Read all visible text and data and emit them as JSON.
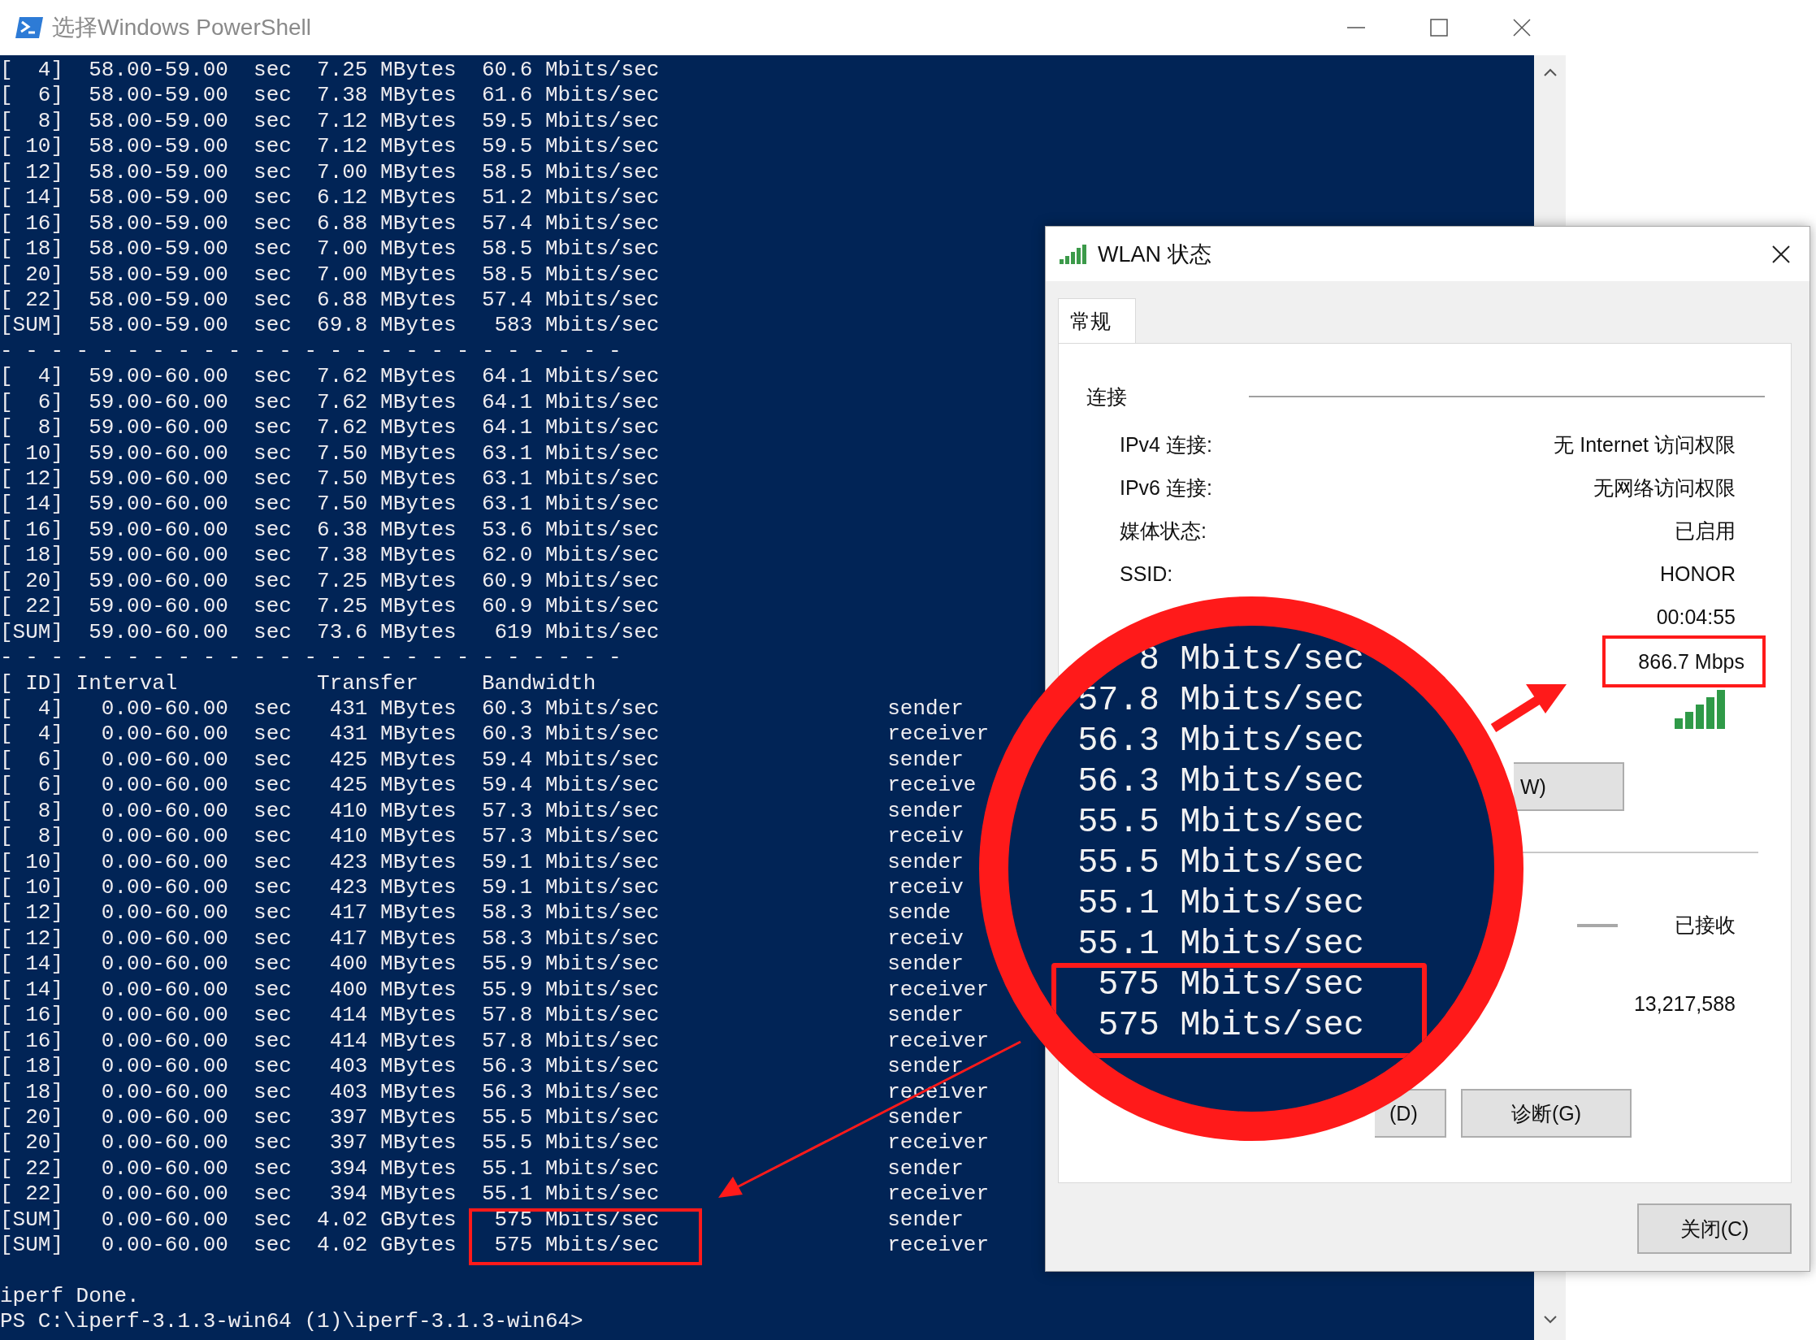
{
  "powershell": {
    "title": "选择Windows PowerShell",
    "lines": [
      {
        "text": "[  4]  58.00-59.00  sec  7.25 MBytes  60.6 Mbits/sec"
      },
      {
        "text": "[  6]  58.00-59.00  sec  7.38 MBytes  61.6 Mbits/sec"
      },
      {
        "text": "[  8]  58.00-59.00  sec  7.12 MBytes  59.5 Mbits/sec"
      },
      {
        "text": "[ 10]  58.00-59.00  sec  7.12 MBytes  59.5 Mbits/sec"
      },
      {
        "text": "[ 12]  58.00-59.00  sec  7.00 MBytes  58.5 Mbits/sec"
      },
      {
        "text": "[ 14]  58.00-59.00  sec  6.12 MBytes  51.2 Mbits/sec"
      },
      {
        "text": "[ 16]  58.00-59.00  sec  6.88 MBytes  57.4 Mbits/sec"
      },
      {
        "text": "[ 18]  58.00-59.00  sec  7.00 MBytes  58.5 Mbits/sec"
      },
      {
        "text": "[ 20]  58.00-59.00  sec  7.00 MBytes  58.5 Mbits/sec"
      },
      {
        "text": "[ 22]  58.00-59.00  sec  6.88 MBytes  57.4 Mbits/sec"
      },
      {
        "text": "[SUM]  58.00-59.00  sec  69.8 MBytes   583 Mbits/sec"
      },
      {
        "text": "- - - - - - - - - - - - - - - - - - - - - - - - -"
      },
      {
        "text": "[  4]  59.00-60.00  sec  7.62 MBytes  64.1 Mbits/sec"
      },
      {
        "text": "[  6]  59.00-60.00  sec  7.62 MBytes  64.1 Mbits/sec"
      },
      {
        "text": "[  8]  59.00-60.00  sec  7.62 MBytes  64.1 Mbits/sec"
      },
      {
        "text": "[ 10]  59.00-60.00  sec  7.50 MBytes  63.1 Mbits/sec"
      },
      {
        "text": "[ 12]  59.00-60.00  sec  7.50 MBytes  63.1 Mbits/sec"
      },
      {
        "text": "[ 14]  59.00-60.00  sec  7.50 MBytes  63.1 Mbits/sec"
      },
      {
        "text": "[ 16]  59.00-60.00  sec  6.38 MBytes  53.6 Mbits/sec"
      },
      {
        "text": "[ 18]  59.00-60.00  sec  7.38 MBytes  62.0 Mbits/sec"
      },
      {
        "text": "[ 20]  59.00-60.00  sec  7.25 MBytes  60.9 Mbits/sec"
      },
      {
        "text": "[ 22]  59.00-60.00  sec  7.25 MBytes  60.9 Mbits/sec"
      },
      {
        "text": "[SUM]  59.00-60.00  sec  73.6 MBytes   619 Mbits/sec"
      },
      {
        "text": "- - - - - - - - - - - - - - - - - - - - - - - - -"
      },
      {
        "text": "[ ID] Interval           Transfer     Bandwidth"
      },
      {
        "text": "[  4]   0.00-60.00  sec   431 MBytes  60.3 Mbits/sec",
        "role": "sender"
      },
      {
        "text": "[  4]   0.00-60.00  sec   431 MBytes  60.3 Mbits/sec",
        "role": "receiver"
      },
      {
        "text": "[  6]   0.00-60.00  sec   425 MBytes  59.4 Mbits/sec",
        "role": "sender"
      },
      {
        "text": "[  6]   0.00-60.00  sec   425 MBytes  59.4 Mbits/sec",
        "role": "receive"
      },
      {
        "text": "[  8]   0.00-60.00  sec   410 MBytes  57.3 Mbits/sec",
        "role": "sender"
      },
      {
        "text": "[  8]   0.00-60.00  sec   410 MBytes  57.3 Mbits/sec",
        "role": "receiv"
      },
      {
        "text": "[ 10]   0.00-60.00  sec   423 MBytes  59.1 Mbits/sec",
        "role": "sender"
      },
      {
        "text": "[ 10]   0.00-60.00  sec   423 MBytes  59.1 Mbits/sec",
        "role": "receiv"
      },
      {
        "text": "[ 12]   0.00-60.00  sec   417 MBytes  58.3 Mbits/sec",
        "role": "sende"
      },
      {
        "text": "[ 12]   0.00-60.00  sec   417 MBytes  58.3 Mbits/sec",
        "role": "receiv"
      },
      {
        "text": "[ 14]   0.00-60.00  sec   400 MBytes  55.9 Mbits/sec",
        "role": "sender"
      },
      {
        "text": "[ 14]   0.00-60.00  sec   400 MBytes  55.9 Mbits/sec",
        "role": "receiver"
      },
      {
        "text": "[ 16]   0.00-60.00  sec   414 MBytes  57.8 Mbits/sec",
        "role": "sender"
      },
      {
        "text": "[ 16]   0.00-60.00  sec   414 MBytes  57.8 Mbits/sec",
        "role": "receiver"
      },
      {
        "text": "[ 18]   0.00-60.00  sec   403 MBytes  56.3 Mbits/sec",
        "role": "sender"
      },
      {
        "text": "[ 18]   0.00-60.00  sec   403 MBytes  56.3 Mbits/sec",
        "role": "receiver"
      },
      {
        "text": "[ 20]   0.00-60.00  sec   397 MBytes  55.5 Mbits/sec",
        "role": "sender"
      },
      {
        "text": "[ 20]   0.00-60.00  sec   397 MBytes  55.5 Mbits/sec",
        "role": "receiver"
      },
      {
        "text": "[ 22]   0.00-60.00  sec   394 MBytes  55.1 Mbits/sec",
        "role": "sender"
      },
      {
        "text": "[ 22]   0.00-60.00  sec   394 MBytes  55.1 Mbits/sec",
        "role": "receiver"
      },
      {
        "text": "[SUM]   0.00-60.00  sec  4.02 GBytes   575 Mbits/sec",
        "role": "sender"
      },
      {
        "text": "[SUM]   0.00-60.00  sec  4.02 GBytes   575 Mbits/sec",
        "role": "receiver"
      }
    ],
    "after_blank_line": [
      "iperf Done.",
      "PS C:\\iperf-3.1.3-win64 (1)\\iperf-3.1.3-win64>"
    ]
  },
  "wlan_dialog": {
    "title": "WLAN 状态",
    "tabs": [
      {
        "label": "常规",
        "selected": true
      }
    ],
    "section": "连接",
    "fields": [
      {
        "label": "IPv4 连接:",
        "value": "无 Internet 访问权限"
      },
      {
        "label": "IPv6 连接:",
        "value": "无网络访问权限"
      },
      {
        "label": "媒体状态:",
        "value": "已启用"
      },
      {
        "label": "SSID:",
        "value": "HONOR"
      },
      {
        "value": "00:04:55"
      },
      {
        "value": "866.7 Mbps"
      }
    ],
    "partial_button": "W)",
    "received_label": "已接收",
    "received_bytes": "13,217,588",
    "buttons": [
      "(D)",
      "诊断(G)"
    ],
    "close_button": "关闭(C)"
  },
  "magnifier": {
    "lines": [
      "8 Mbits/sec",
      "57.8 Mbits/sec",
      "56.3 Mbits/sec",
      "56.3 Mbits/sec",
      "55.5 Mbits/sec",
      "55.5 Mbits/sec",
      "55.1 Mbits/sec",
      "55.1 Mbits/sec",
      "575 Mbits/sec",
      "575 Mbits/sec"
    ]
  }
}
